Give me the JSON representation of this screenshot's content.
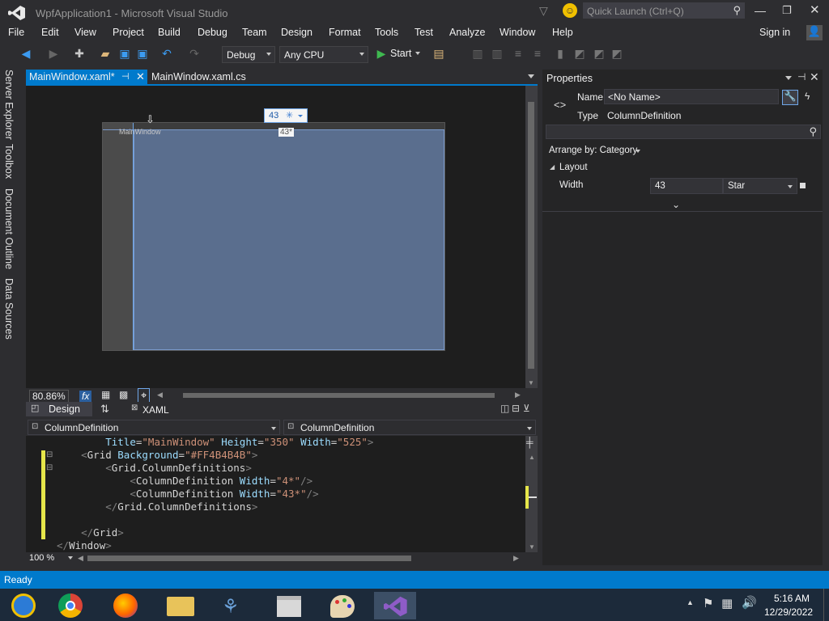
{
  "window": {
    "title": "WpfApplication1 - Microsoft Visual Studio",
    "quick_launch_placeholder": "Quick Launch (Ctrl+Q)"
  },
  "menu": [
    "File",
    "Edit",
    "View",
    "Project",
    "Build",
    "Debug",
    "Team",
    "Design",
    "Format",
    "Tools",
    "Test",
    "Analyze",
    "Window",
    "Help"
  ],
  "signin": "Sign in",
  "toolbar": {
    "config": "Debug",
    "platform": "Any CPU",
    "start": "Start"
  },
  "left_tabs": [
    "Server Explorer",
    "Toolbox",
    "Document Outline",
    "Data Sources"
  ],
  "doc_tabs": [
    {
      "label": "MainWindow.xaml*",
      "active": true
    },
    {
      "label": "MainWindow.xaml.cs",
      "active": false
    }
  ],
  "designer": {
    "window_title": "MainWindow",
    "column_popup_value": "43",
    "column_popup_symbol": "✳",
    "column_marker": "43*",
    "zoom": "80.86%"
  },
  "view_tabs": {
    "design": "Design",
    "xaml": "XAML"
  },
  "nav": {
    "left": "ColumnDefinition",
    "right": "ColumnDefinition"
  },
  "code_lines": [
    {
      "indent": "        ",
      "parts": [
        [
          "att",
          "Title"
        ],
        [
          "el",
          "="
        ],
        [
          "str",
          "\"MainWindow\""
        ],
        [
          "el",
          " "
        ],
        [
          "att",
          "Height"
        ],
        [
          "el",
          "="
        ],
        [
          "str",
          "\"350\""
        ],
        [
          "el",
          " "
        ],
        [
          "att",
          "Width"
        ],
        [
          "el",
          "="
        ],
        [
          "str",
          "\"525\""
        ],
        [
          "tag",
          ">"
        ]
      ]
    },
    {
      "indent": "    ",
      "parts": [
        [
          "tag",
          "<"
        ],
        [
          "el",
          "Grid"
        ],
        [
          "el",
          " "
        ],
        [
          "att",
          "Background"
        ],
        [
          "el",
          "="
        ],
        [
          "str",
          "\"#FF4B4B4B\""
        ],
        [
          "tag",
          ">"
        ]
      ]
    },
    {
      "indent": "        ",
      "parts": [
        [
          "tag",
          "<"
        ],
        [
          "el",
          "Grid.ColumnDefinitions"
        ],
        [
          "tag",
          ">"
        ]
      ]
    },
    {
      "indent": "            ",
      "parts": [
        [
          "tag",
          "<"
        ],
        [
          "el",
          "ColumnDefinition"
        ],
        [
          "el",
          " "
        ],
        [
          "att",
          "Width"
        ],
        [
          "el",
          "="
        ],
        [
          "str",
          "\"4*\""
        ],
        [
          "tag",
          "/>"
        ]
      ]
    },
    {
      "indent": "            ",
      "parts": [
        [
          "tag",
          "<"
        ],
        [
          "el",
          "ColumnDefinition"
        ],
        [
          "el",
          " "
        ],
        [
          "att",
          "Width"
        ],
        [
          "el",
          "="
        ],
        [
          "str",
          "\"43*\""
        ],
        [
          "tag",
          "/>"
        ]
      ]
    },
    {
      "indent": "        ",
      "parts": [
        [
          "tag",
          "</"
        ],
        [
          "el",
          "Grid.ColumnDefinitions"
        ],
        [
          "tag",
          ">"
        ]
      ]
    },
    {
      "indent": "",
      "parts": []
    },
    {
      "indent": "    ",
      "parts": [
        [
          "tag",
          "</"
        ],
        [
          "el",
          "Grid"
        ],
        [
          "tag",
          ">"
        ]
      ]
    },
    {
      "indent": "",
      "parts": [
        [
          "tag",
          "</"
        ],
        [
          "el",
          "Window"
        ],
        [
          "tag",
          ">"
        ]
      ]
    }
  ],
  "code_zoom": "100 %",
  "properties": {
    "title": "Properties",
    "name_label": "Name",
    "name_value": "<No Name>",
    "type_label": "Type",
    "type_value": "ColumnDefinition",
    "arrange_by": "Arrange by: Category",
    "category": "Layout",
    "width_label": "Width",
    "width_value": "43",
    "width_unit": "Star"
  },
  "status": "Ready",
  "clock": {
    "time": "5:16 AM",
    "date": "12/29/2022"
  },
  "colors": {
    "accent": "#007acc",
    "vs_purple": "#68217a",
    "grid_bg": "#4b4b4b",
    "selected_col": "#5a6e8e"
  }
}
